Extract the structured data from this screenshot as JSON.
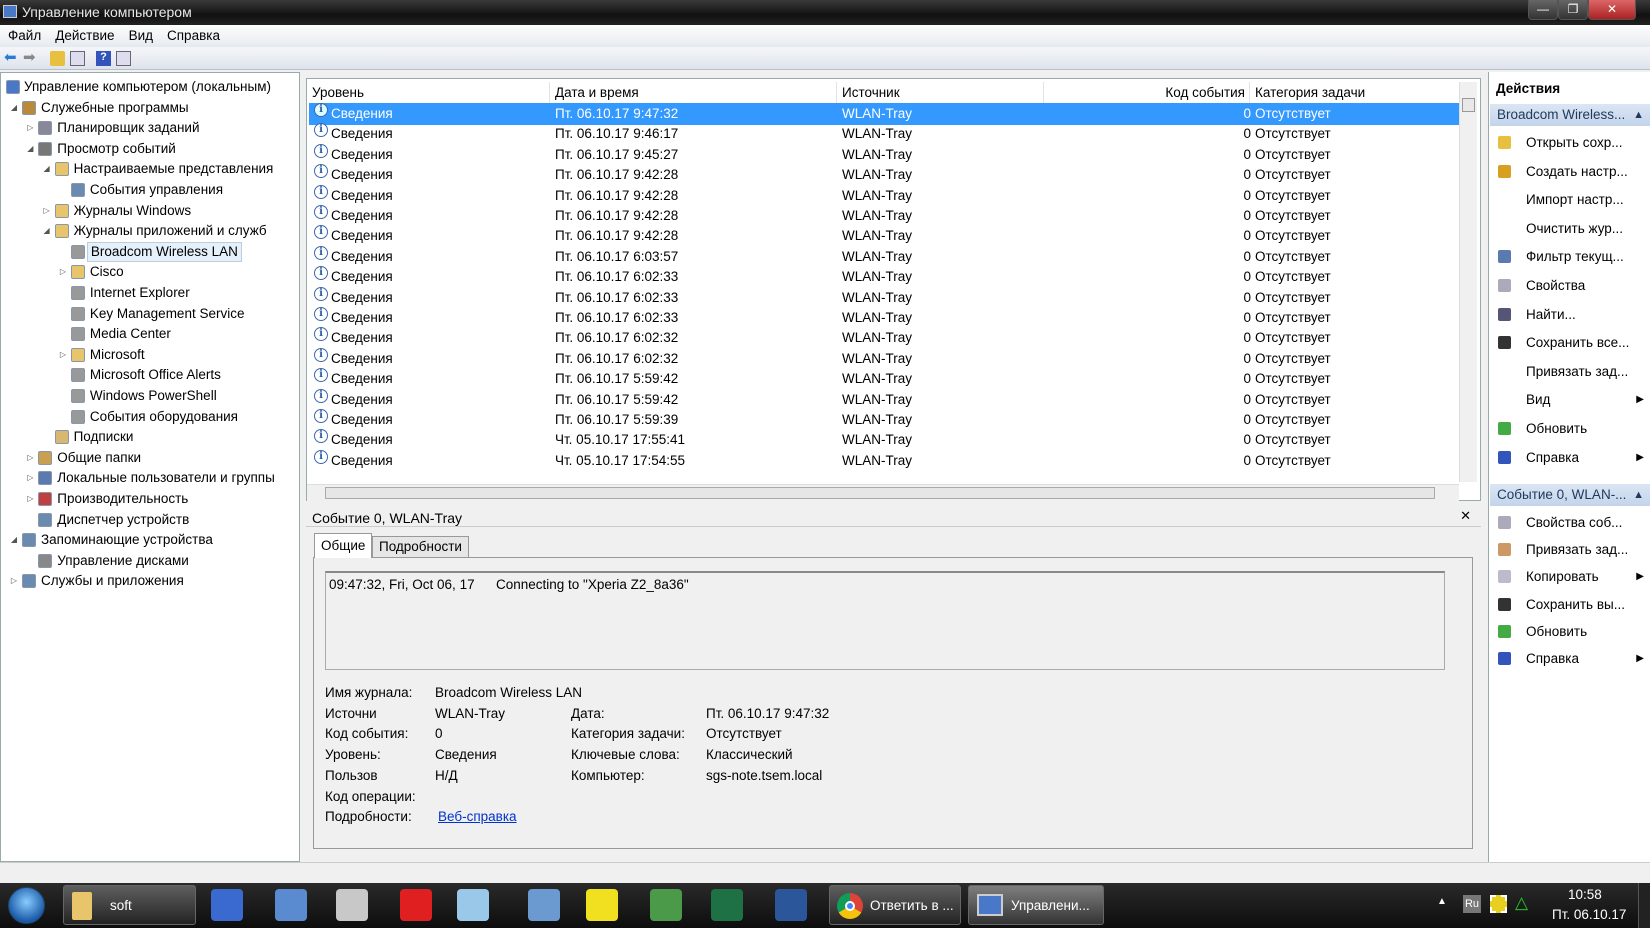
{
  "window": {
    "title": "Управление компьютером",
    "min": "—",
    "max": "❐",
    "close": "✕"
  },
  "menu": [
    "Файл",
    "Действие",
    "Вид",
    "Справка"
  ],
  "tree": [
    {
      "label": "Управление компьютером (локальным)",
      "level": 0,
      "exp": "",
      "icon": "computer-management-icon",
      "color": "#4a78c8"
    },
    {
      "label": "Служебные программы",
      "level": 1,
      "exp": "open",
      "icon": "tools-icon",
      "color": "#b88a3a"
    },
    {
      "label": "Планировщик заданий",
      "level": 2,
      "exp": "closed",
      "icon": "clock-icon",
      "color": "#889"
    },
    {
      "label": "Просмотр событий",
      "level": 2,
      "exp": "open",
      "icon": "event-viewer-icon",
      "color": "#777"
    },
    {
      "label": "Настраиваемые представления",
      "level": 3,
      "exp": "open",
      "icon": "folder-icon",
      "color": "#e8c46a"
    },
    {
      "label": "События управления",
      "level": 4,
      "exp": "",
      "icon": "filter-icon",
      "color": "#6a8ab0"
    },
    {
      "label": "Журналы Windows",
      "level": 3,
      "exp": "closed",
      "icon": "folder-icon",
      "color": "#e8c46a"
    },
    {
      "label": "Журналы приложений и служб",
      "level": 3,
      "exp": "open",
      "icon": "folder-icon",
      "color": "#e8c46a"
    },
    {
      "label": "Broadcom Wireless LAN",
      "level": 4,
      "exp": "",
      "icon": "log-icon",
      "color": "#999",
      "selected": true
    },
    {
      "label": "Cisco",
      "level": 4,
      "exp": "closed",
      "icon": "folder-icon",
      "color": "#e8c46a"
    },
    {
      "label": "Internet Explorer",
      "level": 4,
      "exp": "",
      "icon": "log-icon",
      "color": "#999"
    },
    {
      "label": "Key Management Service",
      "level": 4,
      "exp": "",
      "icon": "log-icon",
      "color": "#999"
    },
    {
      "label": "Media Center",
      "level": 4,
      "exp": "",
      "icon": "log-icon",
      "color": "#999"
    },
    {
      "label": "Microsoft",
      "level": 4,
      "exp": "closed",
      "icon": "folder-icon",
      "color": "#e8c46a"
    },
    {
      "label": "Microsoft Office Alerts",
      "level": 4,
      "exp": "",
      "icon": "log-icon",
      "color": "#999"
    },
    {
      "label": "Windows PowerShell",
      "level": 4,
      "exp": "",
      "icon": "log-icon",
      "color": "#999"
    },
    {
      "label": "События оборудования",
      "level": 4,
      "exp": "",
      "icon": "log-icon",
      "color": "#999"
    },
    {
      "label": "Подписки",
      "level": 3,
      "exp": "",
      "icon": "subscriptions-icon",
      "color": "#d8b870"
    },
    {
      "label": "Общие папки",
      "level": 2,
      "exp": "closed",
      "icon": "shared-folders-icon",
      "color": "#c9a050"
    },
    {
      "label": "Локальные пользователи и группы",
      "level": 2,
      "exp": "closed",
      "icon": "users-icon",
      "color": "#5a7ab0"
    },
    {
      "label": "Производительность",
      "level": 2,
      "exp": "closed",
      "icon": "performance-icon",
      "color": "#c04040"
    },
    {
      "label": "Диспетчер устройств",
      "level": 2,
      "exp": "",
      "icon": "device-manager-icon",
      "color": "#6a8ab0"
    },
    {
      "label": "Запоминающие устройства",
      "level": 1,
      "exp": "open",
      "icon": "storage-icon",
      "color": "#6a8ab0"
    },
    {
      "label": "Управление дисками",
      "level": 2,
      "exp": "",
      "icon": "disk-icon",
      "color": "#888"
    },
    {
      "label": "Службы и приложения",
      "level": 1,
      "exp": "closed",
      "icon": "services-icon",
      "color": "#6a8ab0"
    }
  ],
  "grid": {
    "headers": [
      "Уровень",
      "Дата и время",
      "Источник",
      "Код события",
      "Категория задачи"
    ],
    "rows": [
      {
        "level": "Сведения",
        "date": "Пт. 06.10.17 9:47:32",
        "source": "WLAN-Tray",
        "code": "0",
        "category": "Отсутствует"
      },
      {
        "level": "Сведения",
        "date": "Пт. 06.10.17 9:46:17",
        "source": "WLAN-Tray",
        "code": "0",
        "category": "Отсутствует"
      },
      {
        "level": "Сведения",
        "date": "Пт. 06.10.17 9:45:27",
        "source": "WLAN-Tray",
        "code": "0",
        "category": "Отсутствует"
      },
      {
        "level": "Сведения",
        "date": "Пт. 06.10.17 9:42:28",
        "source": "WLAN-Tray",
        "code": "0",
        "category": "Отсутствует"
      },
      {
        "level": "Сведения",
        "date": "Пт. 06.10.17 9:42:28",
        "source": "WLAN-Tray",
        "code": "0",
        "category": "Отсутствует"
      },
      {
        "level": "Сведения",
        "date": "Пт. 06.10.17 9:42:28",
        "source": "WLAN-Tray",
        "code": "0",
        "category": "Отсутствует"
      },
      {
        "level": "Сведения",
        "date": "Пт. 06.10.17 9:42:28",
        "source": "WLAN-Tray",
        "code": "0",
        "category": "Отсутствует"
      },
      {
        "level": "Сведения",
        "date": "Пт. 06.10.17 6:03:57",
        "source": "WLAN-Tray",
        "code": "0",
        "category": "Отсутствует"
      },
      {
        "level": "Сведения",
        "date": "Пт. 06.10.17 6:02:33",
        "source": "WLAN-Tray",
        "code": "0",
        "category": "Отсутствует"
      },
      {
        "level": "Сведения",
        "date": "Пт. 06.10.17 6:02:33",
        "source": "WLAN-Tray",
        "code": "0",
        "category": "Отсутствует"
      },
      {
        "level": "Сведения",
        "date": "Пт. 06.10.17 6:02:33",
        "source": "WLAN-Tray",
        "code": "0",
        "category": "Отсутствует"
      },
      {
        "level": "Сведения",
        "date": "Пт. 06.10.17 6:02:32",
        "source": "WLAN-Tray",
        "code": "0",
        "category": "Отсутствует"
      },
      {
        "level": "Сведения",
        "date": "Пт. 06.10.17 6:02:32",
        "source": "WLAN-Tray",
        "code": "0",
        "category": "Отсутствует"
      },
      {
        "level": "Сведения",
        "date": "Пт. 06.10.17 5:59:42",
        "source": "WLAN-Tray",
        "code": "0",
        "category": "Отсутствует"
      },
      {
        "level": "Сведения",
        "date": "Пт. 06.10.17 5:59:42",
        "source": "WLAN-Tray",
        "code": "0",
        "category": "Отсутствует"
      },
      {
        "level": "Сведения",
        "date": "Пт. 06.10.17 5:59:39",
        "source": "WLAN-Tray",
        "code": "0",
        "category": "Отсутствует"
      },
      {
        "level": "Сведения",
        "date": "Чт. 05.10.17 17:55:41",
        "source": "WLAN-Tray",
        "code": "0",
        "category": "Отсутствует"
      },
      {
        "level": "Сведения",
        "date": "Чт. 05.10.17 17:54:55",
        "source": "WLAN-Tray",
        "code": "0",
        "category": "Отсутствует"
      }
    ]
  },
  "preview": {
    "title": "Событие 0, WLAN-Tray",
    "tabs": [
      "Общие",
      "Подробности"
    ],
    "message_time": "09:47:32, Fri, Oct 06, 17",
    "message_text": "Connecting to \"Xperia Z2_8a36\"",
    "fields_left": [
      {
        "label": "Имя журнала:",
        "value": "Broadcom Wireless LAN"
      },
      {
        "label": "Источни",
        "value": "WLAN-Tray"
      },
      {
        "label": "Код события:",
        "value": "0"
      },
      {
        "label": "Уровень:",
        "value": "Сведения"
      },
      {
        "label": "Пользов",
        "value": "Н/Д"
      },
      {
        "label": "Код операции:",
        "value": ""
      }
    ],
    "fields_right": [
      {
        "label": "Дата:",
        "value": "Пт. 06.10.17 9:47:32"
      },
      {
        "label": "Категория задачи:",
        "value": "Отсутствует"
      },
      {
        "label": "Ключевые слова:",
        "value": "Классический"
      },
      {
        "label": "Компьютер:",
        "value": "sgs-note.tsem.local"
      }
    ],
    "details_label": "Подробности:",
    "details_link": "Веб-справка"
  },
  "actions": {
    "title": "Действия",
    "groups": [
      {
        "header": "Broadcom Wireless...",
        "items": [
          {
            "label": "Открыть сохр...",
            "icon": "open-folder-icon",
            "color": "#e8c040"
          },
          {
            "label": "Создать настр...",
            "icon": "filter-create-icon",
            "color": "#d8a020"
          },
          {
            "label": "Импорт настр...",
            "icon": "",
            "color": ""
          },
          {
            "label": "Очистить жур...",
            "icon": "",
            "color": ""
          },
          {
            "label": "Фильтр текущ...",
            "icon": "filter-icon",
            "color": "#5a7ab0"
          },
          {
            "label": "Свойства",
            "icon": "properties-icon",
            "color": "#aab"
          },
          {
            "label": "Найти...",
            "icon": "find-icon",
            "color": "#557"
          },
          {
            "label": "Сохранить все...",
            "icon": "save-icon",
            "color": "#333"
          },
          {
            "label": "Привязать зад...",
            "icon": "",
            "color": ""
          },
          {
            "label": "Вид",
            "icon": "",
            "color": "",
            "sub": true
          },
          {
            "label": "Обновить",
            "icon": "refresh-icon",
            "color": "#4a4"
          },
          {
            "label": "Справка",
            "icon": "help-icon",
            "color": "#3355bb",
            "sub": true
          }
        ]
      },
      {
        "header": "Событие 0, WLAN-...",
        "items": [
          {
            "label": "Свойства соб...",
            "icon": "event-properties-icon",
            "color": "#aab"
          },
          {
            "label": "Привязать зад...",
            "icon": "attach-task-icon",
            "color": "#c96"
          },
          {
            "label": "Копировать",
            "icon": "copy-icon",
            "color": "#bbc",
            "sub": true
          },
          {
            "label": "Сохранить вы...",
            "icon": "save-icon",
            "color": "#333"
          },
          {
            "label": "Обновить",
            "icon": "refresh-icon",
            "color": "#4a4"
          },
          {
            "label": "Справка",
            "icon": "help-icon",
            "color": "#3355bb",
            "sub": true
          }
        ]
      }
    ]
  },
  "taskbar": {
    "folder_label": "soft",
    "pinned": [
      {
        "name": "network-computer-icon",
        "color": "#3a6ad0"
      },
      {
        "name": "network-map-icon",
        "color": "#5a8ad0"
      },
      {
        "name": "scanner-icon",
        "color": "#c8c8c8"
      },
      {
        "name": "cityinfo-icon",
        "color": "#e02020"
      },
      {
        "name": "notepad-icon",
        "color": "#9ac8e8"
      },
      {
        "name": "calculator-icon",
        "color": "#6a9ad0"
      },
      {
        "name": "1c-icon",
        "color": "#f0e020"
      },
      {
        "name": "globe-icon",
        "color": "#4a9a4a"
      },
      {
        "name": "excel-icon",
        "color": "#1e7145"
      },
      {
        "name": "word-icon",
        "color": "#2b579a"
      }
    ],
    "chrome_label": "Ответить в ...",
    "mmc_label": "Управлени...",
    "lang": "Ru",
    "time": "10:58",
    "date": "Пт. 06.10.17"
  }
}
